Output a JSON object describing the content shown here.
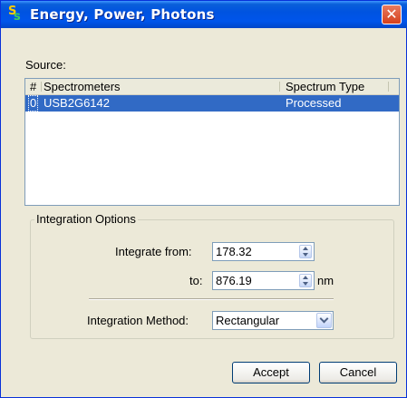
{
  "window": {
    "title": "Energy, Power, Photons",
    "app_icon": "spectrasuite-icon",
    "close_glyph": "✕"
  },
  "source": {
    "label": "Source:",
    "columns": [
      "#",
      "Spectrometers",
      "Spectrum Type"
    ],
    "rows": [
      {
        "index": "0",
        "spectrometer": "USB2G6142",
        "spectrum_type": "Processed",
        "selected": true
      }
    ]
  },
  "integration_options": {
    "legend": "Integration Options",
    "from_label": "Integrate from:",
    "from_value": "178.32",
    "to_label": "to:",
    "to_value": "876.19",
    "unit": "nm",
    "method_label": "Integration Method:",
    "method_value": "Rectangular"
  },
  "buttons": {
    "accept": "Accept",
    "cancel": "Cancel"
  },
  "colors": {
    "titlebar": "#0054e3",
    "selection": "#316ac5",
    "dialog_bg": "#ece9d8"
  }
}
